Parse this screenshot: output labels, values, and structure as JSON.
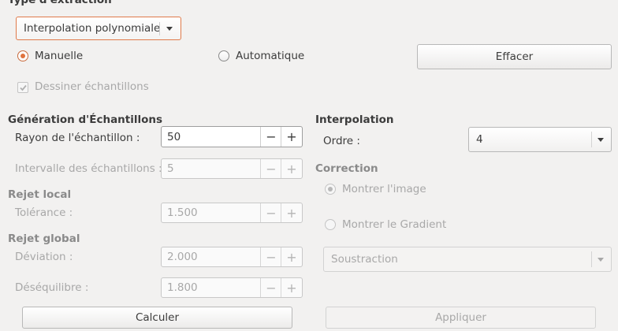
{
  "extraction": {
    "title": "Type d'extraction",
    "type_select_value": "Interpolation polynomiale",
    "radio_manual": "Manuelle",
    "radio_auto": "Automatique",
    "clear_button": "Effacer",
    "draw_samples": "Dessiner échantillons"
  },
  "sampling": {
    "title": "Génération d'Échantillons",
    "radius_label": "Rayon de l'échantillon :",
    "radius_value": "50",
    "interval_label": "Intervalle des échantillons :",
    "interval_value": "5"
  },
  "local_reject": {
    "title": "Rejet local",
    "tolerance_label": "Tolérance :",
    "tolerance_value": "1.500"
  },
  "global_reject": {
    "title": "Rejet global",
    "deviation_label": "Déviation :",
    "deviation_value": "2.000",
    "imbalance_label": "Déséquilibre :",
    "imbalance_value": "1.800"
  },
  "interpolation": {
    "title": "Interpolation",
    "order_label": "Ordre :",
    "order_value": "4"
  },
  "correction": {
    "title": "Correction",
    "show_image": "Montrer l'image",
    "show_gradient": "Montrer le Gradient",
    "method_value": "Soustraction"
  },
  "actions": {
    "compute": "Calculer",
    "apply": "Appliquer"
  },
  "spin": {
    "minus": "−",
    "plus": "+"
  }
}
